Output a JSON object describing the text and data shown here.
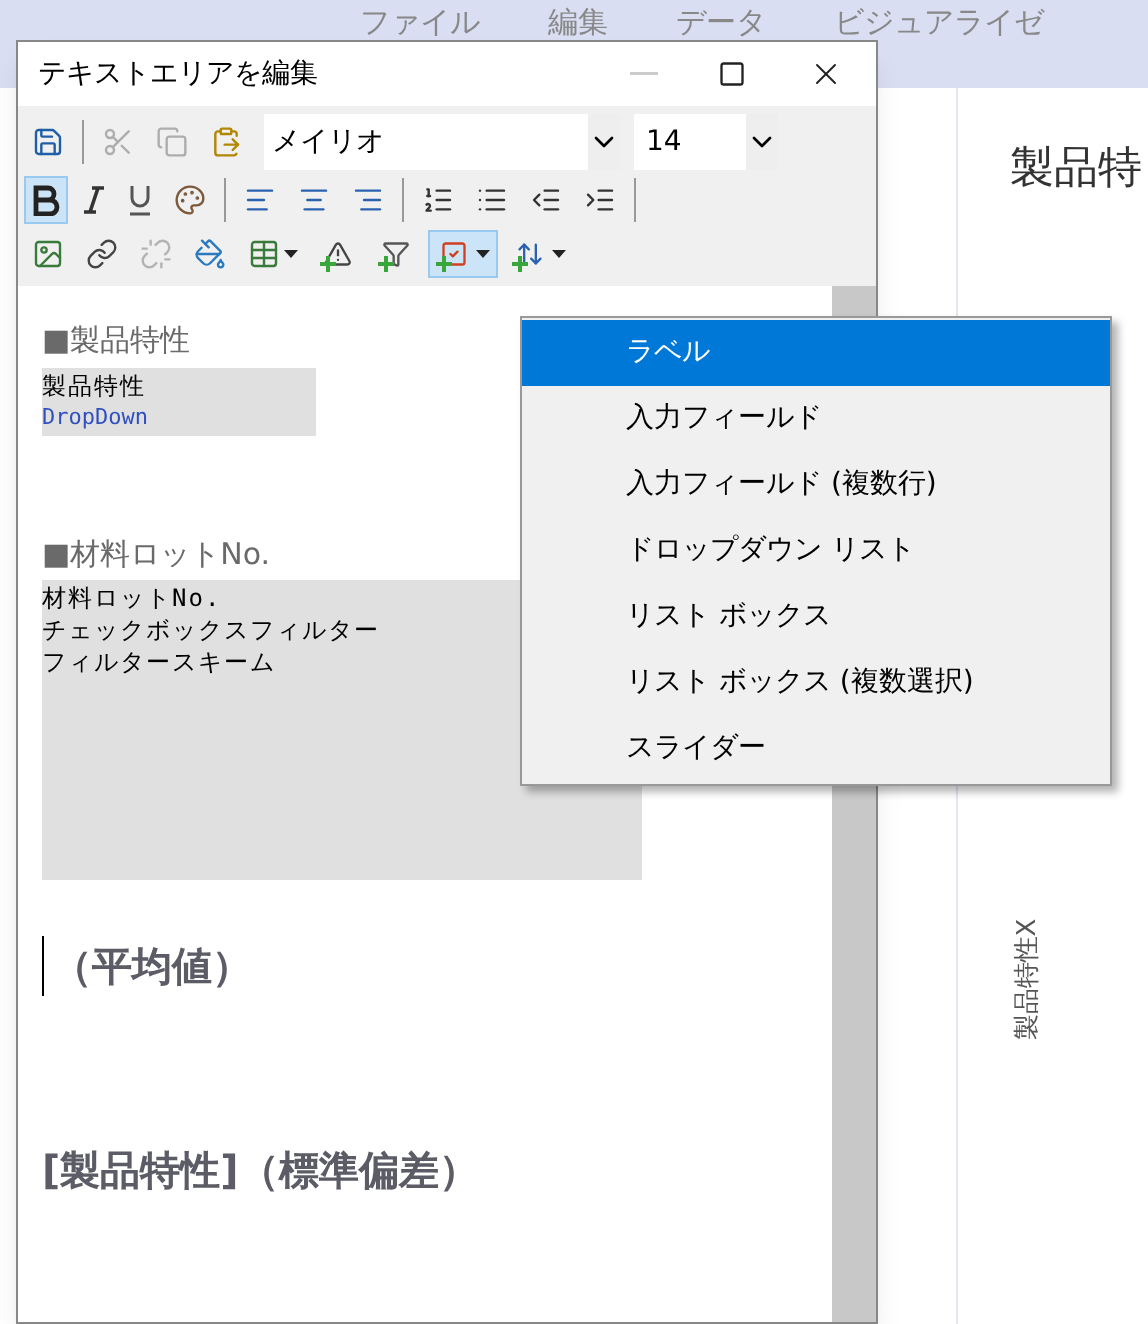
{
  "app_menu": [
    {
      "label": "ファイル"
    },
    {
      "label": "編集"
    },
    {
      "label": "データ"
    },
    {
      "label": "ビジュアライゼ"
    }
  ],
  "app_heading": "製品特",
  "axis_label": "製品特性X",
  "window": {
    "title": "テキストエリアを編集",
    "minimize_disabled": true
  },
  "font": {
    "value": "メイリオ"
  },
  "font_size": {
    "value": "14"
  },
  "toolbar_rows": [
    [
      {
        "disabled": false,
        "pressed": false
      },
      {
        "disabled": true,
        "pressed": false
      },
      {
        "disabled": true,
        "pressed": false
      },
      {
        "disabled": false,
        "pressed": false
      }
    ],
    [
      {
        "disabled": false,
        "pressed": true
      },
      {
        "disabled": false,
        "pressed": false
      },
      {
        "disabled": false,
        "pressed": false
      },
      {
        "disabled": false,
        "pressed": false
      },
      {
        "disabled": false,
        "pressed": false
      },
      {
        "disabled": false,
        "pressed": false
      },
      {
        "disabled": false,
        "pressed": false
      },
      {
        "disabled": false,
        "pressed": false
      },
      {
        "disabled": false,
        "pressed": false
      },
      {
        "disabled": false,
        "pressed": false
      },
      {
        "disabled": false,
        "pressed": false
      }
    ],
    [
      {
        "disabled": false,
        "pressed": false
      },
      {
        "disabled": false,
        "pressed": false
      },
      {
        "disabled": true,
        "pressed": false
      },
      {
        "disabled": false,
        "pressed": false
      },
      {
        "disabled": false,
        "pressed": false
      },
      {
        "disabled": false,
        "pressed": false
      },
      {
        "disabled": false,
        "pressed": false
      },
      {
        "disabled": false,
        "pressed": true
      },
      {
        "disabled": false,
        "pressed": false
      }
    ]
  ],
  "content": [
    {
      "kind": "heading",
      "text": "■製品特性"
    },
    {
      "kind": "code",
      "lines": [
        "製品特性"
      ],
      "link": "DropDown"
    },
    {
      "kind": "heading",
      "text": "■材料ロットNo."
    },
    {
      "kind": "code",
      "lines": [
        "材料ロットNo.",
        "チェックボックスフィルター",
        "フィルタースキーム"
      ]
    },
    {
      "kind": "bold",
      "text": "（平均値）",
      "caret": true
    },
    {
      "kind": "bold",
      "text": "[製品特性]（標準偏差）",
      "caret": false
    }
  ],
  "dropdown_menu": [
    {
      "label": "ラベル",
      "selected": true
    },
    {
      "label": "入力フィールド",
      "selected": false
    },
    {
      "label": "入力フィールド (複数行)",
      "selected": false
    },
    {
      "label": "ドロップダウン リスト",
      "selected": false
    },
    {
      "label": "リスト ボックス",
      "selected": false
    },
    {
      "label": "リスト ボックス (複数選択)",
      "selected": false
    },
    {
      "label": "スライダー",
      "selected": false
    }
  ]
}
